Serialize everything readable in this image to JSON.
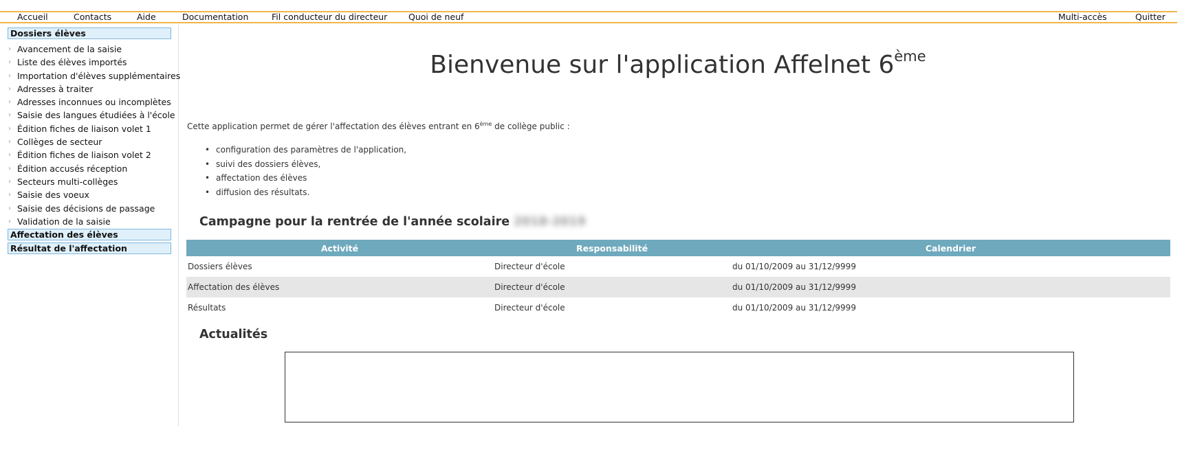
{
  "topmenu": {
    "left": [
      "Accueil",
      "Contacts",
      "Aide",
      "Documentation",
      "Fil conducteur du directeur",
      "Quoi de neuf"
    ],
    "right": [
      "Multi-accès",
      "Quitter"
    ]
  },
  "sidebar": {
    "section1": "Dossiers élèves",
    "items": [
      "Avancement de la saisie",
      "Liste des élèves importés",
      "Importation d'élèves supplémentaires",
      "Adresses à traiter",
      "Adresses inconnues ou incomplètes",
      "Saisie des langues étudiées à l'école",
      "Édition fiches de liaison volet 1",
      "Collèges de secteur",
      "Édition fiches de liaison volet 2",
      "Édition accusés réception",
      "Secteurs multi-collèges",
      "Saisie des voeux",
      "Saisie des décisions de passage",
      "Validation de la saisie"
    ],
    "section2": "Affectation des élèves",
    "section3": "Résultat de l'affectation"
  },
  "main": {
    "title": "Bienvenue sur l'application Affelnet 6",
    "title_sup": "ème",
    "intro_before": "Cette application permet de gérer l'affectation des élèves entrant en 6",
    "intro_sup": "ème",
    "intro_after": " de collège public :",
    "bullets": [
      "configuration des paramètres de l'application,",
      "suivi des dossiers élèves,",
      "affectation des élèves",
      "diffusion des résultats."
    ],
    "campaign_title": "Campagne pour la rentrée de l'année scolaire",
    "campaign_year": "2018-2019",
    "table": {
      "headers": [
        "Activité",
        "Responsabilité",
        "Calendrier"
      ],
      "rows": [
        [
          "Dossiers élèves",
          "Directeur d'école",
          "du 01/10/2009 au 31/12/9999"
        ],
        [
          "Affectation des élèves",
          "Directeur d'école",
          "du 01/10/2009 au 31/12/9999"
        ],
        [
          "Résultats",
          "Directeur d'école",
          "du 01/10/2009 au 31/12/9999"
        ]
      ]
    },
    "news_title": "Actualités"
  }
}
